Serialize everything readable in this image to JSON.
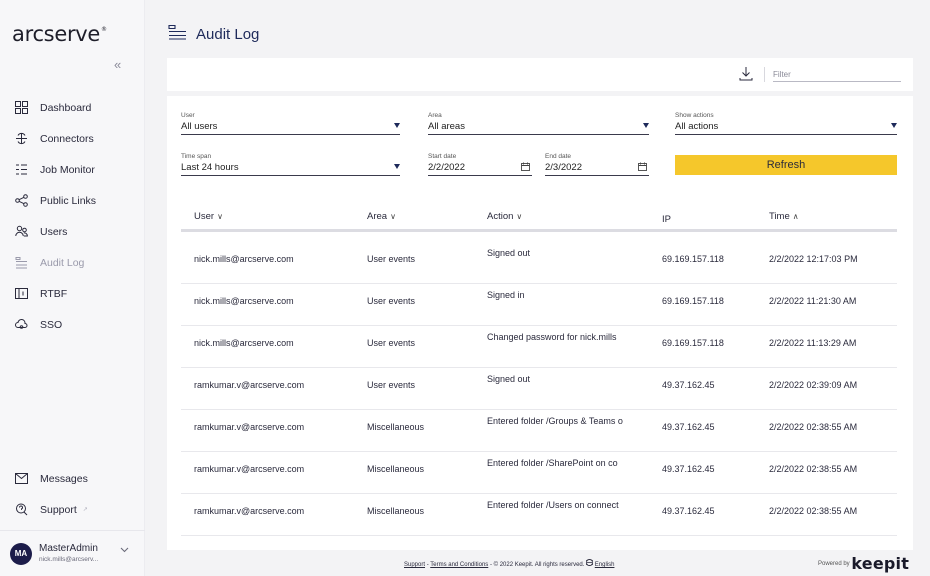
{
  "sidebar": {
    "logo": "arcserve",
    "logo_mark": "®",
    "collapse": "«",
    "items": [
      {
        "label": "Dashboard"
      },
      {
        "label": "Connectors"
      },
      {
        "label": "Job Monitor"
      },
      {
        "label": "Public Links"
      },
      {
        "label": "Users"
      },
      {
        "label": "Audit Log"
      },
      {
        "label": "RTBF"
      },
      {
        "label": "SSO"
      }
    ],
    "bottom": [
      {
        "label": "Messages"
      },
      {
        "label": "Support"
      }
    ],
    "user": {
      "initials": "MA",
      "name": "MasterAdmin",
      "email": "nick.mills@arcserv..."
    }
  },
  "page": {
    "title": "Audit Log"
  },
  "toolbar": {
    "filter_placeholder": "Filter"
  },
  "filters": {
    "user": {
      "label": "User",
      "value": "All users"
    },
    "area": {
      "label": "Area",
      "value": "All areas"
    },
    "show_actions": {
      "label": "Show actions",
      "value": "All actions"
    },
    "time_span": {
      "label": "Time span",
      "value": "Last 24 hours"
    },
    "start_date": {
      "label": "Start date",
      "value": "2/2/2022"
    },
    "end_date": {
      "label": "End date",
      "value": "2/3/2022"
    },
    "refresh": "Refresh"
  },
  "table": {
    "headers": {
      "user": "User",
      "area": "Area",
      "action": "Action",
      "ip": "IP",
      "time": "Time"
    },
    "rows": [
      {
        "user": "nick.mills@arcserve.com",
        "area": "User events",
        "action": "Signed out",
        "ip": "69.169.157.118",
        "time": "2/2/2022 12:17:03 PM"
      },
      {
        "user": "nick.mills@arcserve.com",
        "area": "User events",
        "action": "Signed in",
        "ip": "69.169.157.118",
        "time": "2/2/2022 11:21:30 AM"
      },
      {
        "user": "nick.mills@arcserve.com",
        "area": "User events",
        "action": "Changed password for nick.mills",
        "ip": "69.169.157.118",
        "time": "2/2/2022 11:13:29 AM"
      },
      {
        "user": "ramkumar.v@arcserve.com",
        "area": "User events",
        "action": "Signed out",
        "ip": "49.37.162.45",
        "time": "2/2/2022 02:39:09 AM"
      },
      {
        "user": "ramkumar.v@arcserve.com",
        "area": "Miscellaneous",
        "action": "Entered folder /Groups & Teams o",
        "ip": "49.37.162.45",
        "time": "2/2/2022 02:38:55 AM"
      },
      {
        "user": "ramkumar.v@arcserve.com",
        "area": "Miscellaneous",
        "action": "Entered folder /SharePoint on co",
        "ip": "49.37.162.45",
        "time": "2/2/2022 02:38:55 AM"
      },
      {
        "user": "ramkumar.v@arcserve.com",
        "area": "Miscellaneous",
        "action": "Entered folder /Users on connect",
        "ip": "49.37.162.45",
        "time": "2/2/2022 02:38:55 AM"
      }
    ]
  },
  "footer": {
    "support": "Support",
    "sep1": "-",
    "terms": "Terms and Conditions",
    "copyright": "- © 2022 Keepit. All rights reserved.",
    "language": "English",
    "powered_by": "Powered by",
    "brand": "keepit"
  }
}
